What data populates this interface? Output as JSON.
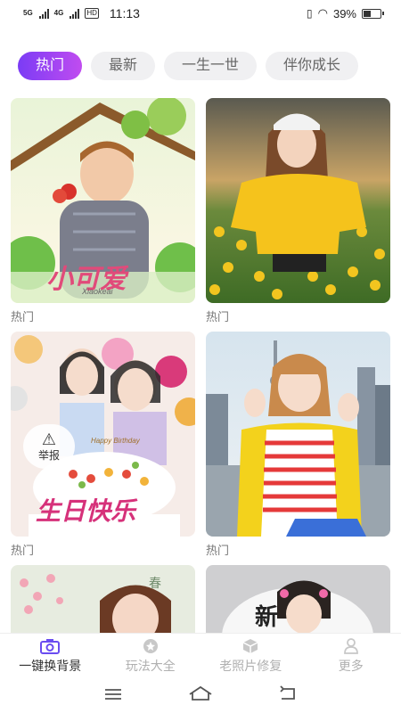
{
  "status_bar": {
    "network1": "5G",
    "network2": "4G",
    "hd": "HD",
    "time": "11:13",
    "battery_text": "39%",
    "battery_level": 0.39
  },
  "tabs": [
    {
      "label": "热门",
      "active": true
    },
    {
      "label": "最新",
      "active": false
    },
    {
      "label": "一生一世",
      "active": false
    },
    {
      "label": "伴你成长",
      "active": false
    }
  ],
  "cards": [
    {
      "caption": "热门",
      "art_text": "小可爱",
      "art_sub": "Xiaokeai"
    },
    {
      "caption": "热门"
    },
    {
      "caption": "热门",
      "art_text": "生日快乐",
      "art_sub": "Happy Birthday",
      "report_label": "举报"
    },
    {
      "caption": "热门"
    },
    {
      "caption": ""
    },
    {
      "caption": "",
      "art_text": "新"
    }
  ],
  "bottom_nav": [
    {
      "label": "一键换背景",
      "icon": "camera-icon",
      "active": true
    },
    {
      "label": "玩法大全",
      "icon": "star-icon",
      "active": false
    },
    {
      "label": "老照片修复",
      "icon": "cube-icon",
      "active": false
    },
    {
      "label": "更多",
      "icon": "person-icon",
      "active": false
    }
  ],
  "system_nav": [
    "menu-icon",
    "home-icon",
    "back-icon"
  ],
  "colors": {
    "accent_start": "#7b3cf5",
    "accent_end": "#c04cf0",
    "nav_active_icon": "#6a4cf0"
  }
}
